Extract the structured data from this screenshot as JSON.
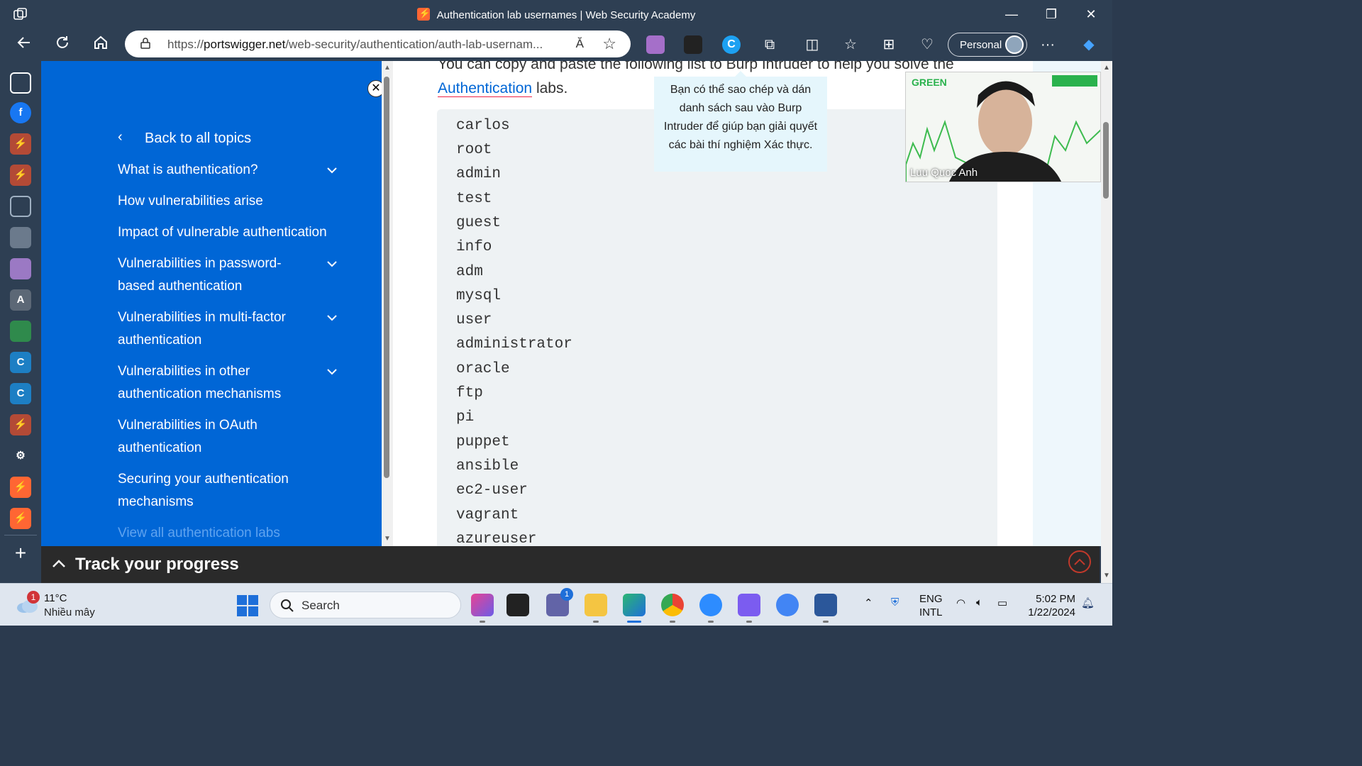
{
  "window": {
    "title": "Authentication lab usernames | Web Security Academy",
    "minimize": "—",
    "restore": "❐",
    "close": "✕"
  },
  "navbar": {
    "url_scheme": "https://",
    "url_domain": "portswigger.net",
    "url_path": "/web-security/authentication/auth-lab-usernam...",
    "read_aloud": "Ă",
    "profile_label": "Personal",
    "more": "···"
  },
  "sidebar": {
    "back_label": "Back to all topics",
    "items": [
      {
        "label": "What is authentication?",
        "expandable": true
      },
      {
        "label": "How vulnerabilities arise",
        "expandable": false
      },
      {
        "label": "Impact of vulnerable authentication",
        "expandable": false
      },
      {
        "label": "Vulnerabilities in password-based authentication",
        "expandable": true
      },
      {
        "label": "Vulnerabilities in multi-factor authentication",
        "expandable": true
      },
      {
        "label": "Vulnerabilities in other authentication mechanisms",
        "expandable": true
      },
      {
        "label": "Vulnerabilities in OAuth authentication",
        "expandable": false
      },
      {
        "label": "Securing your authentication mechanisms",
        "expandable": false
      },
      {
        "label": "View all authentication labs",
        "expandable": false
      }
    ]
  },
  "content": {
    "intro_text": "You can copy and paste the following list to Burp Intruder to help you solve the",
    "intro_link": "Authentication",
    "intro_suffix": " labs.",
    "usernames": [
      "carlos",
      "root",
      "admin",
      "test",
      "guest",
      "info",
      "adm",
      "mysql",
      "user",
      "administrator",
      "oracle",
      "ftp",
      "pi",
      "puppet",
      "ansible",
      "ec2-user",
      "vagrant",
      "azureuser"
    ],
    "tooltip": "Bạn có thể sao chép và dán danh sách sau vào Burp Intruder để giúp bạn giải quyết các bài thí nghiệm Xác thực."
  },
  "video": {
    "participant_name": "Luu Quoc Anh",
    "logo_text": "GREEN"
  },
  "progress": {
    "label": "Track your progress"
  },
  "taskbar": {
    "weather_temp": "11°C",
    "weather_condition": "Nhiều mây",
    "weather_badge": "1",
    "search_placeholder": "Search",
    "teams_badge": "1",
    "lang_top": "ENG",
    "lang_bottom": "INTL",
    "time": "5:02 PM",
    "date": "1/22/2024"
  },
  "colors": {
    "sidebar_bg": "#0066d6",
    "chrome_bg": "#2e3f53",
    "progress_bg": "#2a2a2a",
    "accent_orange": "#ff6633"
  }
}
